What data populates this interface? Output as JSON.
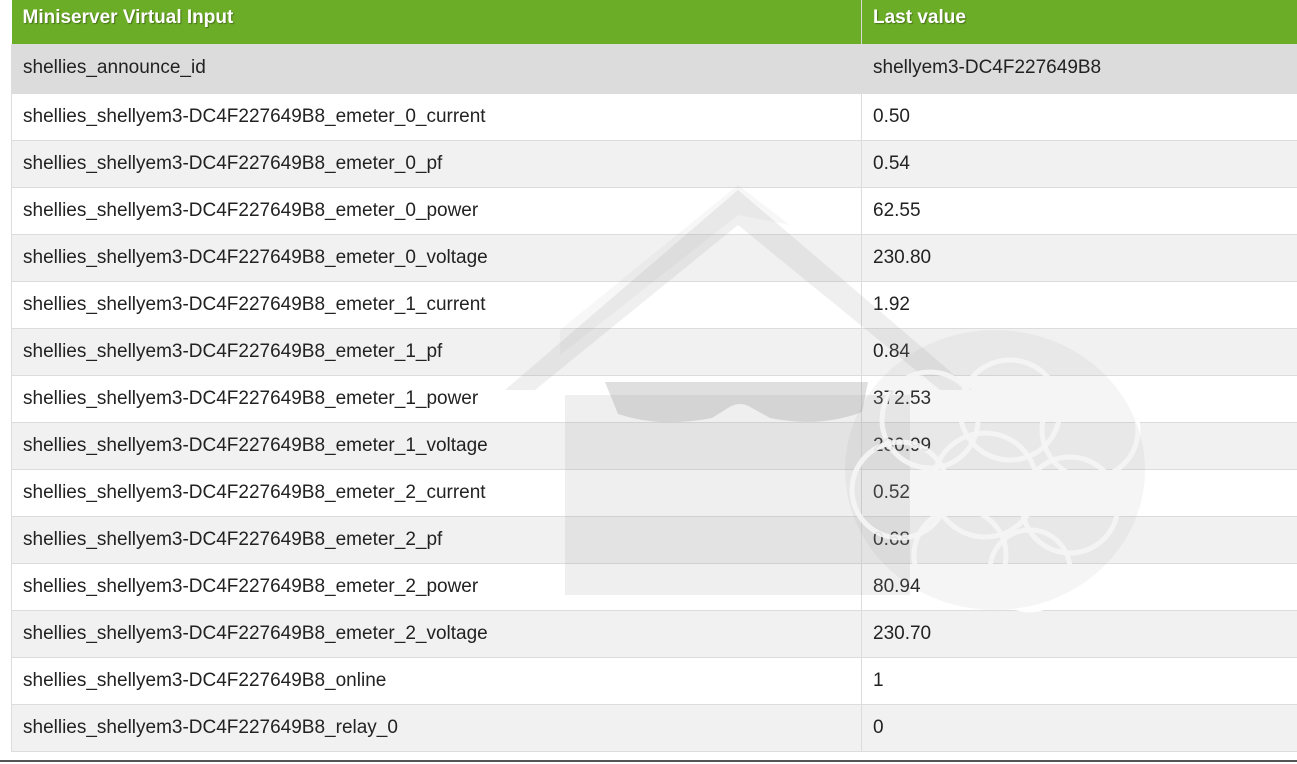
{
  "table": {
    "headers": [
      "Miniserver Virtual Input",
      "Last value"
    ],
    "rows": [
      {
        "name": "shellies_announce_id",
        "value": "shellyem3-DC4F227649B8"
      },
      {
        "name": "shellies_shellyem3-DC4F227649B8_emeter_0_current",
        "value": "0.50"
      },
      {
        "name": "shellies_shellyem3-DC4F227649B8_emeter_0_pf",
        "value": "0.54"
      },
      {
        "name": "shellies_shellyem3-DC4F227649B8_emeter_0_power",
        "value": "62.55"
      },
      {
        "name": "shellies_shellyem3-DC4F227649B8_emeter_0_voltage",
        "value": "230.80"
      },
      {
        "name": "shellies_shellyem3-DC4F227649B8_emeter_1_current",
        "value": "1.92"
      },
      {
        "name": "shellies_shellyem3-DC4F227649B8_emeter_1_pf",
        "value": "0.84"
      },
      {
        "name": "shellies_shellyem3-DC4F227649B8_emeter_1_power",
        "value": "372.53"
      },
      {
        "name": "shellies_shellyem3-DC4F227649B8_emeter_1_voltage",
        "value": "230.99"
      },
      {
        "name": "shellies_shellyem3-DC4F227649B8_emeter_2_current",
        "value": "0.52"
      },
      {
        "name": "shellies_shellyem3-DC4F227649B8_emeter_2_pf",
        "value": "0.68"
      },
      {
        "name": "shellies_shellyem3-DC4F227649B8_emeter_2_power",
        "value": "80.94"
      },
      {
        "name": "shellies_shellyem3-DC4F227649B8_emeter_2_voltage",
        "value": "230.70"
      },
      {
        "name": "shellies_shellyem3-DC4F227649B8_online",
        "value": "1"
      },
      {
        "name": "shellies_shellyem3-DC4F227649B8_relay_0",
        "value": "0"
      }
    ]
  },
  "colors": {
    "header_bg": "#6cad27",
    "header_text": "#ffffff",
    "row_highlight": "#dcdcdc",
    "row_alt": "#f1f1f1",
    "watermark": "#d8d8d8"
  },
  "icons": {
    "watermark": "house-with-sunglasses-and-raspberry-watermark-icon"
  }
}
